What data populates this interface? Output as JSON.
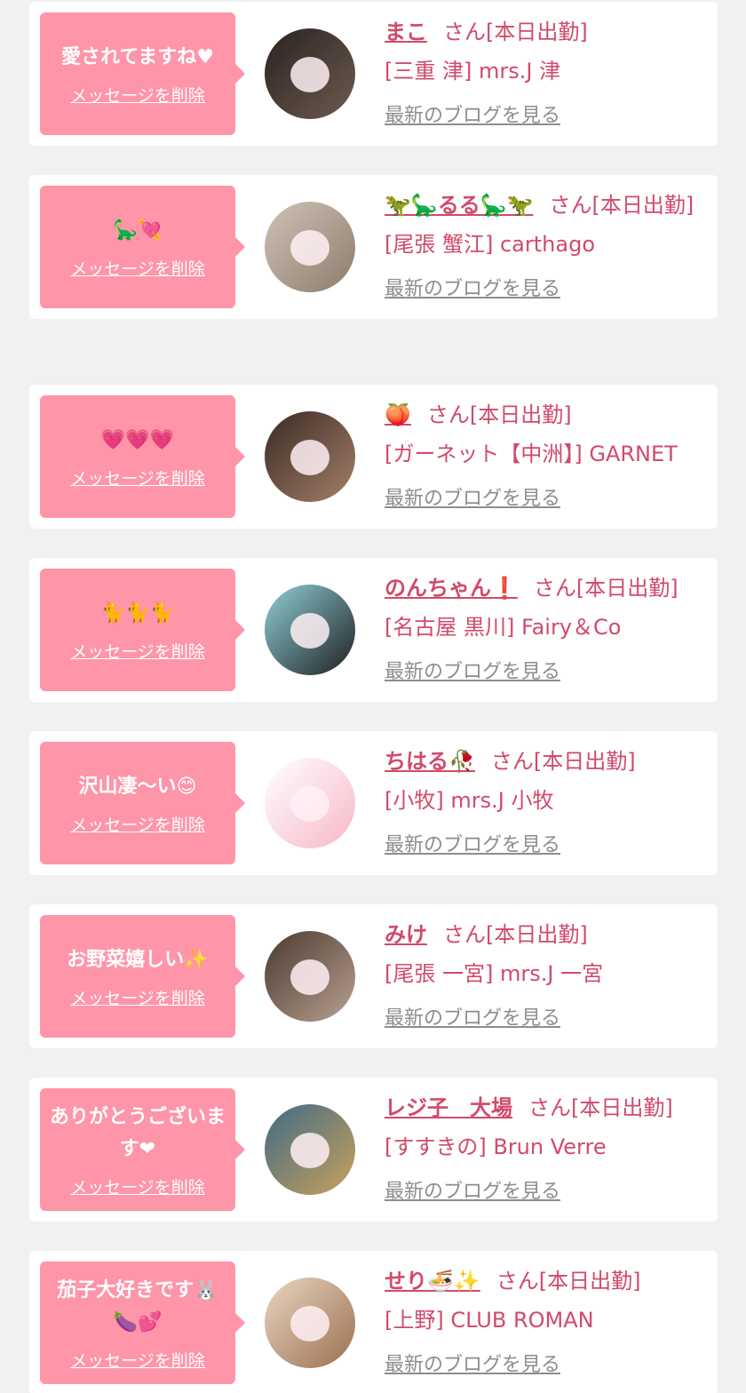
{
  "items": [
    {
      "message": "愛されてますね♥",
      "delete_label": "メッセージを削除",
      "name": "まこ",
      "suffix": "さん[本日出勤]",
      "shop": "[三重 津] mrs.J 津",
      "blog_label": "最新のブログを見る",
      "avatar_icon": "girl-photo-icon",
      "avatar_colors": [
        "#2a2320",
        "#6d5a50"
      ]
    },
    {
      "message": "🦕💘",
      "delete_label": "メッセージを削除",
      "name": "🦖🦕るる🦕🦖",
      "suffix": "さん[本日出勤]",
      "shop": "[尾張 蟹江] carthago",
      "blog_label": "最新のブログを見る",
      "avatar_icon": "girl-photo-icon",
      "avatar_colors": [
        "#cfc3b6",
        "#8c7c6c"
      ]
    },
    {
      "message": "💗💗💗",
      "delete_label": "メッセージを削除",
      "name": "🍑",
      "suffix": "さん[本日出勤]",
      "shop": "[ガーネット【中洲】] GARNET",
      "blog_label": "最新のブログを見る",
      "avatar_icon": "girl-photo-icon",
      "avatar_colors": [
        "#3a2a22",
        "#a4806a"
      ]
    },
    {
      "message": "🐈🐈🐈",
      "delete_label": "メッセージを削除",
      "name": "のんちゃん❗",
      "suffix": "さん[本日出勤]",
      "shop": "[名古屋 黒川] Fairy＆Co",
      "blog_label": "最新のブログを見る",
      "avatar_icon": "girl-photo-icon",
      "avatar_colors": [
        "#8fd0d6",
        "#1f1f22"
      ]
    },
    {
      "message": "沢山凄〜い😊",
      "delete_label": "メッセージを削除",
      "name": "ちはる🥀",
      "suffix": "さん[本日出勤]",
      "shop": "[小牧] mrs.J 小牧",
      "blog_label": "最新のブログを見る",
      "avatar_icon": "plush-toy-icon",
      "avatar_colors": [
        "#ffffff",
        "#f7b7c8"
      ]
    },
    {
      "message": "お野菜嬉しい✨",
      "delete_label": "メッセージを削除",
      "name": "みけ",
      "suffix": "さん[本日出勤]",
      "shop": "[尾張 一宮] mrs.J 一宮",
      "blog_label": "最新のブログを見る",
      "avatar_icon": "girl-photo-icon",
      "avatar_colors": [
        "#4a3a30",
        "#b8a090"
      ]
    },
    {
      "message": "ありがとうございます❤",
      "delete_label": "メッセージを削除",
      "name": "レジ子　大場",
      "suffix": "さん[本日出勤]",
      "shop": "[すすきの] Brun Verre",
      "blog_label": "最新のブログを見る",
      "avatar_icon": "girl-photo-icon",
      "avatar_colors": [
        "#3e6a86",
        "#c9a25a"
      ]
    },
    {
      "message": "茄子大好きです🐰🍆💕",
      "delete_label": "メッセージを削除",
      "name": "せり🍜✨",
      "suffix": "さん[本日出勤]",
      "shop": "[上野] CLUB ROMAN",
      "blog_label": "最新のブログを見る",
      "avatar_icon": "girl-photo-icon",
      "avatar_colors": [
        "#e9d7c4",
        "#9c6e4e"
      ]
    }
  ]
}
